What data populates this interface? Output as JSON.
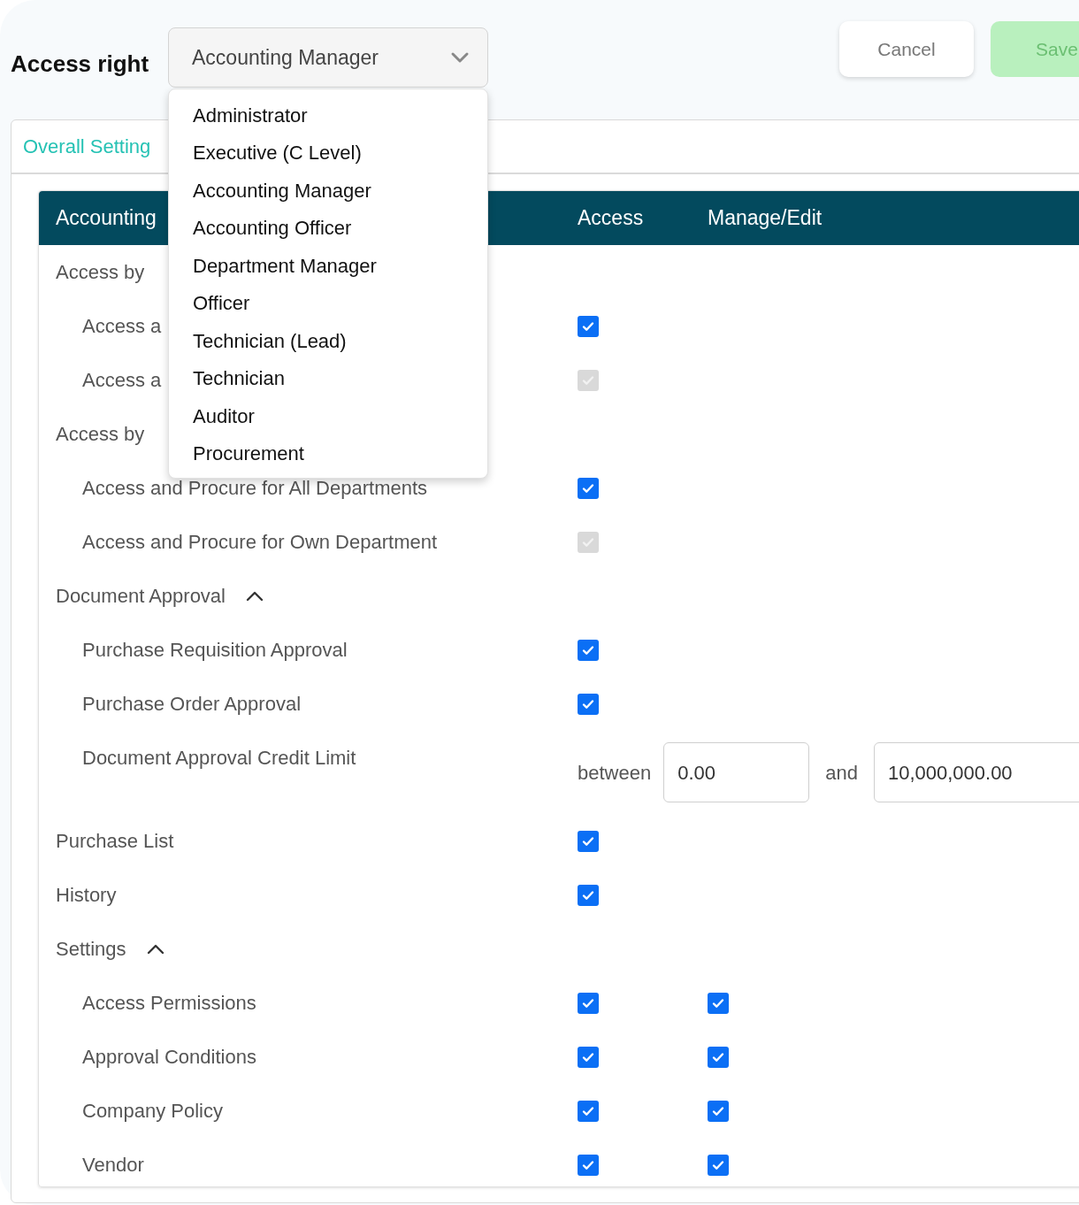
{
  "header": {
    "label": "Access right",
    "select": {
      "value": "Accounting Manager",
      "expanded": true,
      "options": [
        {
          "label": "Administrator"
        },
        {
          "label": "Executive (C Level)"
        },
        {
          "label": "Accounting Manager"
        },
        {
          "label": "Accounting Officer"
        },
        {
          "label": "Department Manager"
        },
        {
          "label": "Officer"
        },
        {
          "label": "Technician (Lead)"
        },
        {
          "label": "Technician"
        },
        {
          "label": "Auditor"
        },
        {
          "label": "Procurement"
        }
      ]
    }
  },
  "buttons": [
    {
      "kind": "secondary",
      "label": "Cancel"
    },
    {
      "kind": "primary",
      "label": "Save"
    }
  ],
  "tabs": [
    {
      "label": "Overall Setting",
      "selected": true
    }
  ],
  "table": {
    "columns": [
      "Accounting",
      "Access",
      "Manage/Edit"
    ],
    "rows": [
      {
        "kind": "group",
        "label": "Access by",
        "children": [
          {
            "kind": "item",
            "label": "Access a",
            "access": {
              "checked": true,
              "disabled": false
            }
          },
          {
            "kind": "item",
            "label": "Access a",
            "access": {
              "checked": true,
              "disabled": true
            }
          }
        ]
      },
      {
        "kind": "group",
        "label": "Access by",
        "children": [
          {
            "kind": "item",
            "label": "Access and Procure for All Departments",
            "access": {
              "checked": true,
              "disabled": false
            }
          },
          {
            "kind": "item",
            "label": "Access and Procure for Own Department",
            "access": {
              "checked": true,
              "disabled": true
            }
          }
        ]
      },
      {
        "kind": "group",
        "label": "Document Approval",
        "expanded": true,
        "children": [
          {
            "kind": "item",
            "label": "Purchase Requisition Approval",
            "access": {
              "checked": true,
              "disabled": false
            }
          },
          {
            "kind": "item",
            "label": "Purchase Order Approval",
            "access": {
              "checked": true,
              "disabled": false
            }
          },
          {
            "kind": "range",
            "label": "Document Approval Credit Limit",
            "from_label": "between",
            "from": "0.00",
            "to_label": "and",
            "to": "10,000,000.00"
          }
        ]
      },
      {
        "kind": "item",
        "label": "Purchase List",
        "access": {
          "checked": true,
          "disabled": false
        }
      },
      {
        "kind": "item",
        "label": "History",
        "access": {
          "checked": true,
          "disabled": false
        }
      },
      {
        "kind": "group",
        "label": "Settings",
        "expanded": true,
        "children": [
          {
            "kind": "item",
            "label": "Access Permissions",
            "access": {
              "checked": true,
              "disabled": false
            },
            "manage": {
              "checked": true,
              "disabled": false
            }
          },
          {
            "kind": "item",
            "label": "Approval Conditions",
            "access": {
              "checked": true,
              "disabled": false
            },
            "manage": {
              "checked": true,
              "disabled": false
            }
          },
          {
            "kind": "item",
            "label": "Company Policy",
            "access": {
              "checked": true,
              "disabled": false
            },
            "manage": {
              "checked": true,
              "disabled": false
            }
          },
          {
            "kind": "item",
            "label": "Vendor",
            "access": {
              "checked": true,
              "disabled": false
            },
            "manage": {
              "checked": true,
              "disabled": false
            }
          }
        ]
      }
    ]
  }
}
